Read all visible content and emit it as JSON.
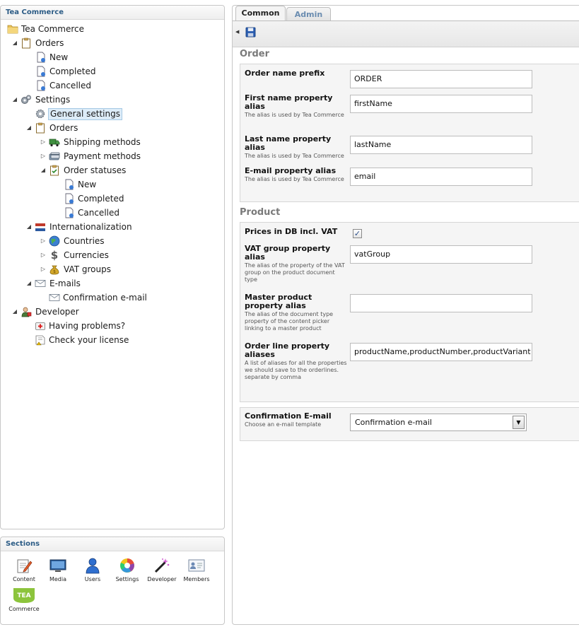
{
  "tree": {
    "title": "Tea Commerce",
    "items": [
      {
        "label": "Tea Commerce",
        "icon": "folder-icon"
      },
      {
        "label": "Orders",
        "icon": "clipboard-icon"
      },
      {
        "label": "New",
        "icon": "document-icon"
      },
      {
        "label": "Completed",
        "icon": "document-icon"
      },
      {
        "label": "Cancelled",
        "icon": "document-icon"
      },
      {
        "label": "Settings",
        "icon": "gears-icon"
      },
      {
        "label": "General settings",
        "icon": "gear-icon"
      },
      {
        "label": "Orders",
        "icon": "clipboard-icon"
      },
      {
        "label": "Shipping methods",
        "icon": "truck-icon"
      },
      {
        "label": "Payment methods",
        "icon": "payment-icon"
      },
      {
        "label": "Order statuses",
        "icon": "clipboard-check-icon"
      },
      {
        "label": "New",
        "icon": "document-icon"
      },
      {
        "label": "Completed",
        "icon": "document-icon"
      },
      {
        "label": "Cancelled",
        "icon": "document-icon"
      },
      {
        "label": "Internationalization",
        "icon": "flag-icon"
      },
      {
        "label": "Countries",
        "icon": "globe-icon"
      },
      {
        "label": "Currencies",
        "icon": "dollar-icon"
      },
      {
        "label": "VAT groups",
        "icon": "money-bag-icon"
      },
      {
        "label": "E-mails",
        "icon": "envelope-icon"
      },
      {
        "label": "Confirmation e-mail",
        "icon": "envelope-icon"
      },
      {
        "label": "Developer",
        "icon": "developer-icon"
      },
      {
        "label": "Having problems?",
        "icon": "first-aid-icon"
      },
      {
        "label": "Check your license",
        "icon": "license-icon"
      }
    ]
  },
  "sections": {
    "title": "Sections",
    "items": [
      {
        "label": "Content",
        "icon": "content-icon"
      },
      {
        "label": "Media",
        "icon": "media-icon"
      },
      {
        "label": "Users",
        "icon": "users-icon"
      },
      {
        "label": "Settings",
        "icon": "settings-icon"
      },
      {
        "label": "Developer",
        "icon": "developer-wand-icon"
      },
      {
        "label": "Members",
        "icon": "members-icon"
      },
      {
        "label": "Commerce",
        "icon": "tea-logo-icon",
        "logo_text": "TEA"
      }
    ]
  },
  "tabs": [
    {
      "label": "Common",
      "active": true
    },
    {
      "label": "Admin",
      "active": false
    }
  ],
  "groups": {
    "order": {
      "title": "Order",
      "fields": [
        {
          "label": "Order name prefix",
          "description": "",
          "value": "ORDER"
        },
        {
          "label": "First name property alias",
          "description": "The alias is used by Tea Commerce",
          "value": "firstName"
        },
        {
          "label": "Last name property alias",
          "description": "The alias is used by Tea Commerce",
          "value": "lastName"
        },
        {
          "label": "E-mail property alias",
          "description": "The alias is used by Tea Commerce",
          "value": "email"
        }
      ]
    },
    "product": {
      "title": "Product",
      "prices_label": "Prices in DB incl. VAT",
      "prices_checked": true,
      "check_mark": "✓",
      "fields": [
        {
          "label": "VAT group property alias",
          "description": "The alias of the property of the VAT group on the product document type",
          "value": "vatGroup"
        },
        {
          "label": "Master product property alias",
          "description": "The alias of the document type property of the content picker linking to a master product",
          "value": ""
        },
        {
          "label": "Order line property aliases",
          "description": "A list of aliases for all the properties we should save to the orderlines.",
          "description2": "separate by comma",
          "value": "productName,productNumber,productVariant"
        }
      ]
    },
    "email": {
      "label": "Confirmation E-mail",
      "description": "Choose an e-mail template",
      "selected": "Confirmation e-mail"
    }
  },
  "colors": {
    "accent": "#2b5b85",
    "selected_bg": "#ddecf8"
  }
}
